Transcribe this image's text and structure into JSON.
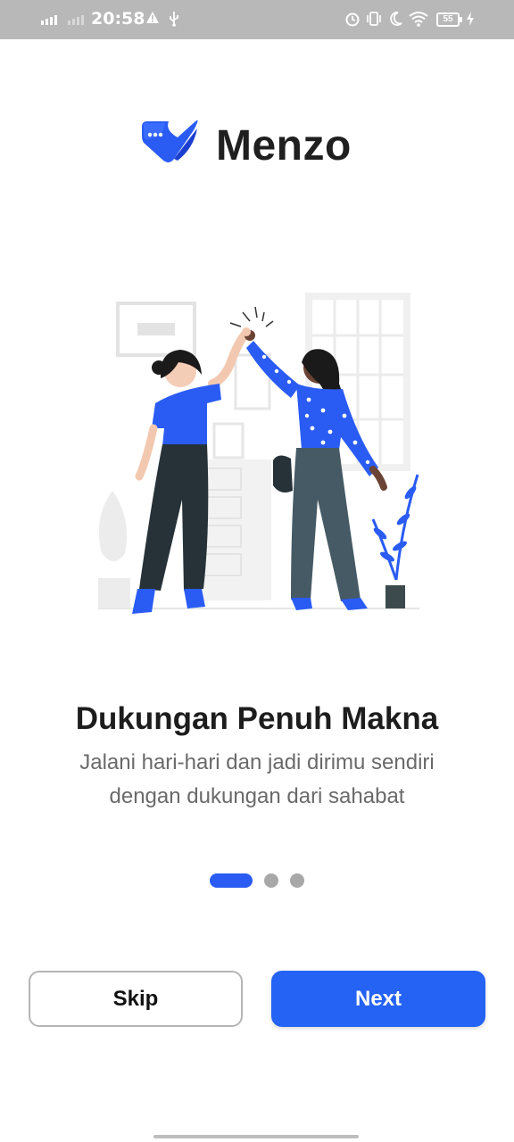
{
  "status_bar": {
    "time": "20:58",
    "battery": "55"
  },
  "brand": {
    "name": "Menzo",
    "accent_color": "#2a5cf4"
  },
  "onboarding": {
    "illustration": "two-women-high-five-illustration",
    "title": "Dukungan Penuh Makna",
    "subtitle_line1": "Jalani hari-hari dan jadi dirimu sendiri",
    "subtitle_line2": "dengan dukungan dari sahabat",
    "page_indicator": {
      "current": 1,
      "total": 3
    }
  },
  "buttons": {
    "skip": "Skip",
    "next": "Next"
  },
  "icons": {
    "status": [
      "signal-icon",
      "signal-weak-icon",
      "alert-icon",
      "usb-icon",
      "alarm-icon",
      "vibrate-icon",
      "do-not-disturb-icon",
      "wifi-icon",
      "battery-icon",
      "charging-icon"
    ]
  }
}
